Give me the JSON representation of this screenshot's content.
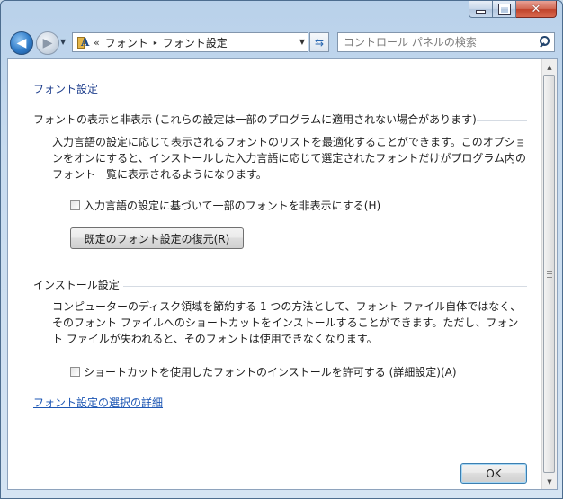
{
  "window": {
    "caption_buttons": {
      "minimize_icon": "minimize-icon",
      "maximize_icon": "maximize-icon",
      "close_icon": "close-icon"
    }
  },
  "nav": {
    "back_glyph": "◀",
    "forward_glyph": "▶",
    "address_icon": "fonts-folder-icon",
    "address_chevron": "«",
    "breadcrumb": [
      "フォント",
      "フォント設定"
    ],
    "breadcrumb_separator": "▸",
    "dropdown_glyph": "▼",
    "refresh_glyph": "⇆",
    "search_placeholder": "コントロール パネルの検索"
  },
  "content": {
    "page_title": "フォント設定",
    "section_display": {
      "heading": "フォントの表示と非表示 (これらの設定は一部のプログラムに適用されない場合があります)",
      "description": "入力言語の設定に応じて表示されるフォントのリストを最適化することができます。このオプションをオンにすると、インストールした入力言語に応じて選定されたフォントだけがプログラム内のフォント一覧に表示されるようになります。",
      "checkbox_label": "入力言語の設定に基づいて一部のフォントを非表示にする(H)",
      "checkbox_checked": false,
      "restore_button": "既定のフォント設定の復元(R)"
    },
    "section_install": {
      "heading": "インストール設定",
      "description": "コンピューターのディスク領域を節約する 1 つの方法として、フォント ファイル自体ではなく、そのフォント ファイルへのショートカットをインストールすることができます。ただし、フォント ファイルが失われると、そのフォントは使用できなくなります。",
      "checkbox_label": "ショートカットを使用したフォントのインストールを許可する (詳細設定)(A)",
      "checkbox_checked": false
    },
    "link_text": "フォント設定の選択の詳細",
    "ok_button": "OK"
  }
}
